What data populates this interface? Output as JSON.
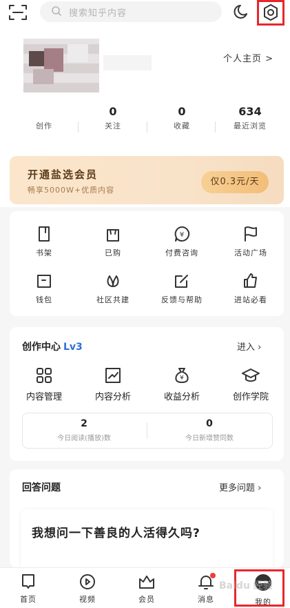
{
  "header": {
    "search_placeholder": "搜索知乎内容",
    "profile_link": "个人主页 >"
  },
  "stats": [
    {
      "value": "",
      "label": "创作"
    },
    {
      "value": "0",
      "label": "关注"
    },
    {
      "value": "0",
      "label": "收藏"
    },
    {
      "value": "634",
      "label": "最近浏览"
    }
  ],
  "vip": {
    "title": "开通盐选会员",
    "subtitle": "畅享5000W+优质内容",
    "button": "仅0.3元/天"
  },
  "quick_grid": [
    {
      "label": "书架",
      "icon": "bookshelf-icon"
    },
    {
      "label": "已购",
      "icon": "bag-icon"
    },
    {
      "label": "付费咨询",
      "icon": "paid-consult-icon"
    },
    {
      "label": "活动广场",
      "icon": "flag-icon"
    },
    {
      "label": "钱包",
      "icon": "wallet-icon"
    },
    {
      "label": "社区共建",
      "icon": "leaf-icon"
    },
    {
      "label": "反馈与帮助",
      "icon": "edit-icon"
    },
    {
      "label": "进站必看",
      "icon": "thumb-icon"
    }
  ],
  "creation": {
    "title": "创作中心",
    "level": "Lv3",
    "enter": "进入",
    "items": [
      {
        "label": "内容管理",
        "icon": "grid-icon"
      },
      {
        "label": "内容分析",
        "icon": "chart-icon"
      },
      {
        "label": "收益分析",
        "icon": "money-bag-icon"
      },
      {
        "label": "创作学院",
        "icon": "graduation-cap-icon"
      }
    ],
    "today": [
      {
        "value": "2",
        "label": "今日阅读(播放)数"
      },
      {
        "value": "0",
        "label": "今日新增赞同数"
      }
    ]
  },
  "answer": {
    "title": "回答问题",
    "more": "更多问题",
    "question": "我想问一下善良的人活得久吗?"
  },
  "tabs": [
    {
      "label": "首页",
      "icon": "home-icon"
    },
    {
      "label": "视频",
      "icon": "video-icon"
    },
    {
      "label": "会员",
      "icon": "crown-icon"
    },
    {
      "label": "消息",
      "icon": "bell-icon"
    },
    {
      "label": "我的",
      "icon": "me-icon"
    }
  ],
  "watermark": "Baidu 经验",
  "colors": {
    "highlight": "#e8262b",
    "level": "#2f6fd6",
    "vip_text": "#5b3a17"
  }
}
